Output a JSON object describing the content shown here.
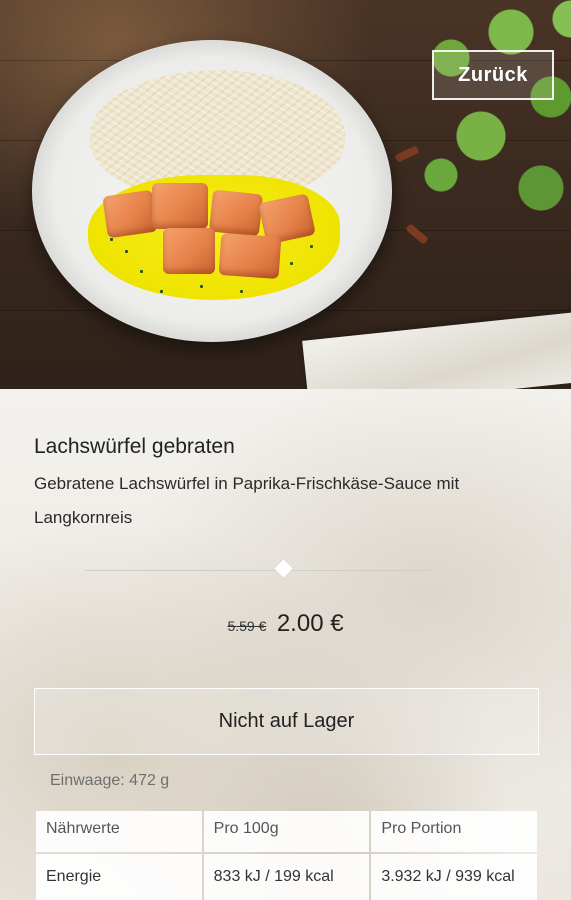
{
  "header": {
    "back_label": "Zurück"
  },
  "dish": {
    "title": "Lachswürfel gebraten",
    "description": "Gebratene Lachswürfel in Paprika-Frischkäse-Sauce mit Langkornreis",
    "old_price": "5.59 €",
    "price": "2.00 €",
    "stock_status": "Nicht auf Lager",
    "weight": "Einwaage: 472 g"
  },
  "nutrition": {
    "headers": [
      "Nährwerte",
      "Pro 100g",
      "Pro Portion"
    ],
    "rows": [
      {
        "label": "Energie",
        "per_100g": "833 kJ / 199 kcal",
        "per_portion": "3.932 kJ / 939 kcal"
      }
    ]
  }
}
